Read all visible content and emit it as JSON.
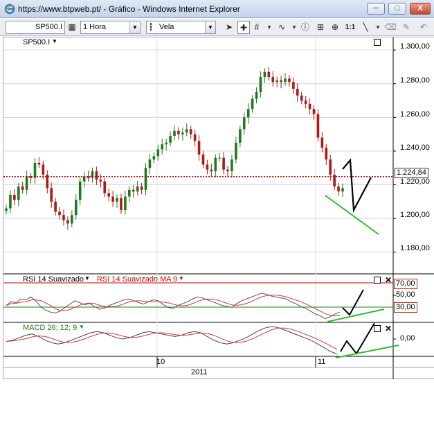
{
  "window": {
    "url": "https://www.btpweb.pt/",
    "title": "https://www.btpweb.pt/ - Gráfico - Windows Internet Explorer",
    "minimize_label": "─",
    "maximize_label": "□",
    "close_label": "X"
  },
  "toolbar": {
    "symbol_value": "SP500.I",
    "interval_value": "1 Hora",
    "chart_type_value": "Vela",
    "zoom_reset_label": "1:1"
  },
  "price_panel": {
    "title": "SP500.I",
    "y_ticks": [
      "1.300,00",
      "1.280,00",
      "1.260,00",
      "1.240,00",
      "1.220,00",
      "1.200,00",
      "1.180,00"
    ],
    "current_price_label": "1.224,84"
  },
  "rsi_panel": {
    "title": "RSI 14 Suavizado",
    "ma_title": "RSI 14 Suavizado MA 9",
    "upper_label": "70,00",
    "mid_label": "50,00",
    "lower_label": "30,00"
  },
  "macd_panel": {
    "title": "MACD 26; 12; 9",
    "zero_label": "0,00"
  },
  "time_axis": {
    "labels": [
      "10",
      "11"
    ],
    "year_label": "2011"
  },
  "colors": {
    "bull_candle": "#1f7a1f",
    "bear_candle": "#b01818",
    "resistance_line": "#cc0000",
    "trend_line_green": "#33bb33",
    "rsi_line": "#555555",
    "rsi_ma_line": "#dd3333",
    "macd_line": "#444444",
    "macd_signal": "#dd3333"
  },
  "chart_data": {
    "type": "line",
    "title": "SP500.I",
    "x_labels": [
      "10",
      "11"
    ],
    "x_group_label": "2011",
    "ylim": [
      1170,
      1305
    ],
    "y_ticks": [
      1180,
      1200,
      1220,
      1240,
      1260,
      1280,
      1300
    ],
    "horizontal_lines": [
      {
        "name": "current price",
        "value": 1224.84,
        "style": "dotted",
        "color": "#cc0000"
      }
    ],
    "series": [
      {
        "name": "SP500.I",
        "values": [
          1206,
          1214,
          1211,
          1219,
          1217,
          1225,
          1224,
          1233,
          1232,
          1226,
          1218,
          1210,
          1204,
          1202,
          1199,
          1197,
          1202,
          1211,
          1222,
          1225,
          1224,
          1228,
          1223,
          1222,
          1215,
          1213,
          1210,
          1212,
          1205,
          1213,
          1217,
          1216,
          1219,
          1217,
          1230,
          1235,
          1237,
          1241,
          1244,
          1245,
          1249,
          1252,
          1250,
          1251,
          1253,
          1250,
          1246,
          1238,
          1232,
          1229,
          1228,
          1236,
          1236,
          1229,
          1228,
          1235,
          1245,
          1253,
          1260,
          1265,
          1271,
          1275,
          1284,
          1287,
          1284,
          1281,
          1282,
          1281,
          1283,
          1281,
          1277,
          1273,
          1270,
          1268,
          1265,
          1262,
          1248,
          1242,
          1235,
          1226,
          1219,
          1216,
          1218
        ]
      }
    ]
  }
}
